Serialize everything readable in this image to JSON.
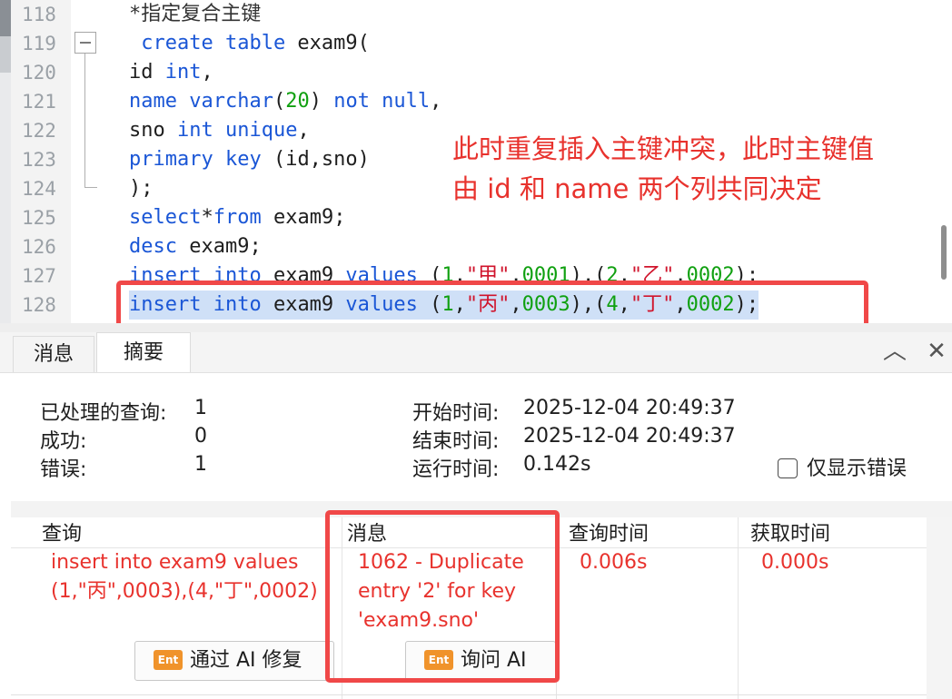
{
  "editor": {
    "lines": [
      {
        "no": "118",
        "tokens": [
          {
            "t": "*指定复合主键",
            "c": "cm"
          }
        ]
      },
      {
        "no": "119",
        "tokens": [
          {
            "t": " create table",
            "c": "kw"
          },
          {
            "t": " exam9(",
            "c": ""
          }
        ]
      },
      {
        "no": "120",
        "tokens": [
          {
            "t": "id ",
            "c": ""
          },
          {
            "t": "int",
            "c": "kw"
          },
          {
            "t": ",",
            "c": ""
          }
        ]
      },
      {
        "no": "121",
        "tokens": [
          {
            "t": "name ",
            "c": "kw"
          },
          {
            "t": "varchar",
            "c": "kw"
          },
          {
            "t": "(",
            "c": ""
          },
          {
            "t": "20",
            "c": "num"
          },
          {
            "t": ") ",
            "c": ""
          },
          {
            "t": "not null",
            "c": "kw"
          },
          {
            "t": ",",
            "c": ""
          }
        ]
      },
      {
        "no": "122",
        "tokens": [
          {
            "t": "sno ",
            "c": ""
          },
          {
            "t": "int unique",
            "c": "kw"
          },
          {
            "t": ",",
            "c": ""
          }
        ]
      },
      {
        "no": "123",
        "tokens": [
          {
            "t": "primary key",
            "c": "kw"
          },
          {
            "t": " (id,sno)",
            "c": ""
          }
        ]
      },
      {
        "no": "124",
        "tokens": [
          {
            "t": ");",
            "c": ""
          }
        ]
      },
      {
        "no": "125",
        "tokens": [
          {
            "t": "select",
            "c": "kw"
          },
          {
            "t": "*",
            "c": ""
          },
          {
            "t": "from",
            "c": "kw"
          },
          {
            "t": " exam9;",
            "c": ""
          }
        ]
      },
      {
        "no": "126",
        "tokens": [
          {
            "t": "desc",
            "c": "kw"
          },
          {
            "t": " exam9;",
            "c": ""
          }
        ]
      },
      {
        "no": "127",
        "tokens": [
          {
            "t": "insert into",
            "c": "kw"
          },
          {
            "t": " exam9 ",
            "c": ""
          },
          {
            "t": "values",
            "c": "kw"
          },
          {
            "t": " (",
            "c": ""
          },
          {
            "t": "1",
            "c": "num"
          },
          {
            "t": ",",
            "c": ""
          },
          {
            "t": "\"甲\"",
            "c": "str"
          },
          {
            "t": ",",
            "c": ""
          },
          {
            "t": "0001",
            "c": "num"
          },
          {
            "t": "),(",
            "c": ""
          },
          {
            "t": "2",
            "c": "num"
          },
          {
            "t": ",",
            "c": ""
          },
          {
            "t": "\"乙\"",
            "c": "str"
          },
          {
            "t": ",",
            "c": ""
          },
          {
            "t": "0002",
            "c": "num"
          },
          {
            "t": ");",
            "c": ""
          }
        ]
      },
      {
        "no": "128",
        "selected": true,
        "tokens": [
          {
            "t": "insert into",
            "c": "kw"
          },
          {
            "t": " exam9 ",
            "c": ""
          },
          {
            "t": "values",
            "c": "kw"
          },
          {
            "t": " (",
            "c": ""
          },
          {
            "t": "1",
            "c": "num"
          },
          {
            "t": ",",
            "c": ""
          },
          {
            "t": "\"丙\"",
            "c": "str"
          },
          {
            "t": ",",
            "c": ""
          },
          {
            "t": "0003",
            "c": "num"
          },
          {
            "t": "),(",
            "c": ""
          },
          {
            "t": "4",
            "c": "num"
          },
          {
            "t": ",",
            "c": ""
          },
          {
            "t": "\"丁\"",
            "c": "str"
          },
          {
            "t": ",",
            "c": ""
          },
          {
            "t": "0002",
            "c": "num"
          },
          {
            "t": ");",
            "c": ""
          }
        ]
      }
    ],
    "annotation_line1": "此时重复插入主键冲突，此时主键值",
    "annotation_line2": "由 id 和 name 两个列共同决定"
  },
  "panel": {
    "tab_messages": "消息",
    "tab_summary": "摘要",
    "collapse_glyph": "︿",
    "close_glyph": "✕",
    "summary": {
      "processed_label": "已处理的查询:",
      "processed_value": "1",
      "success_label": "成功:",
      "success_value": "0",
      "errors_label": "错误:",
      "errors_value": "1",
      "start_label": "开始时间:",
      "start_value": "2025-12-04 20:49:37",
      "end_label": "结束时间:",
      "end_value": "2025-12-04 20:49:37",
      "run_label": "运行时间:",
      "run_value": "0.142s",
      "errors_only_label": "仅显示错误"
    },
    "grid": {
      "headers": {
        "query": "查询",
        "message": "消息",
        "query_time": "查询时间",
        "fetch_time": "获取时间"
      },
      "row": {
        "query_line1": "insert into exam9 values",
        "query_line2": "(1,\"丙\",0003),(4,\"丁\",0002)",
        "message_line1": "1062 - Duplicate",
        "message_line2": "entry '2' for key",
        "message_line3": "'exam9.sno'",
        "query_time": "0.006s",
        "fetch_time": "0.000s"
      },
      "fix_button": "通过 AI 修复",
      "ask_button": "询问 AI",
      "ent_badge": "Ent"
    }
  },
  "colors": {
    "keyword": "#1a56d6",
    "number": "#10a010",
    "string": "#d0142c",
    "annotation": "#e8322d",
    "highlight": "#f04848"
  }
}
